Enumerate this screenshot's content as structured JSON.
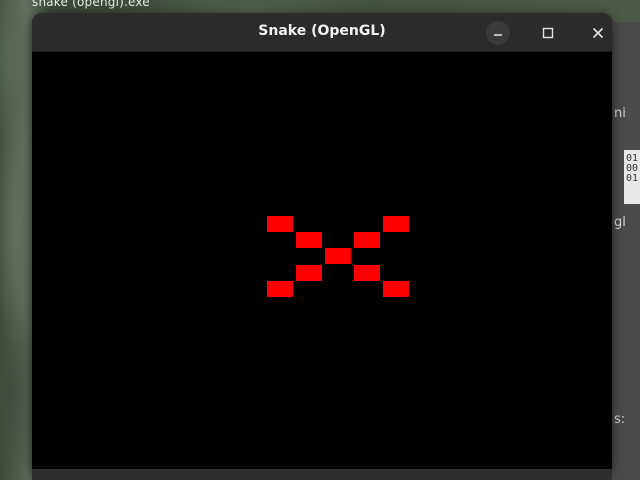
{
  "desktop": {
    "background_window_title": "snake (opengl).exe",
    "side_app_fragments": [
      "ni",
      "gl",
      "s:"
    ],
    "side_app_code_lines": [
      "01",
      "00",
      "01"
    ]
  },
  "window": {
    "title": "Snake (OpenGL)",
    "controls": {
      "minimize_icon": "minimize-icon",
      "maximize_icon": "maximize-icon",
      "close_icon": "close-icon"
    }
  },
  "game": {
    "background_color": "#000000",
    "cell_color": "#ff0000",
    "grid_columns": 20,
    "grid_rows": 26,
    "cells": [
      {
        "col": 8,
        "row": 10
      },
      {
        "col": 12,
        "row": 10
      },
      {
        "col": 9,
        "row": 11
      },
      {
        "col": 11,
        "row": 11
      },
      {
        "col": 10,
        "row": 12
      },
      {
        "col": 9,
        "row": 13
      },
      {
        "col": 11,
        "row": 13
      },
      {
        "col": 8,
        "row": 14
      },
      {
        "col": 12,
        "row": 14
      }
    ]
  }
}
